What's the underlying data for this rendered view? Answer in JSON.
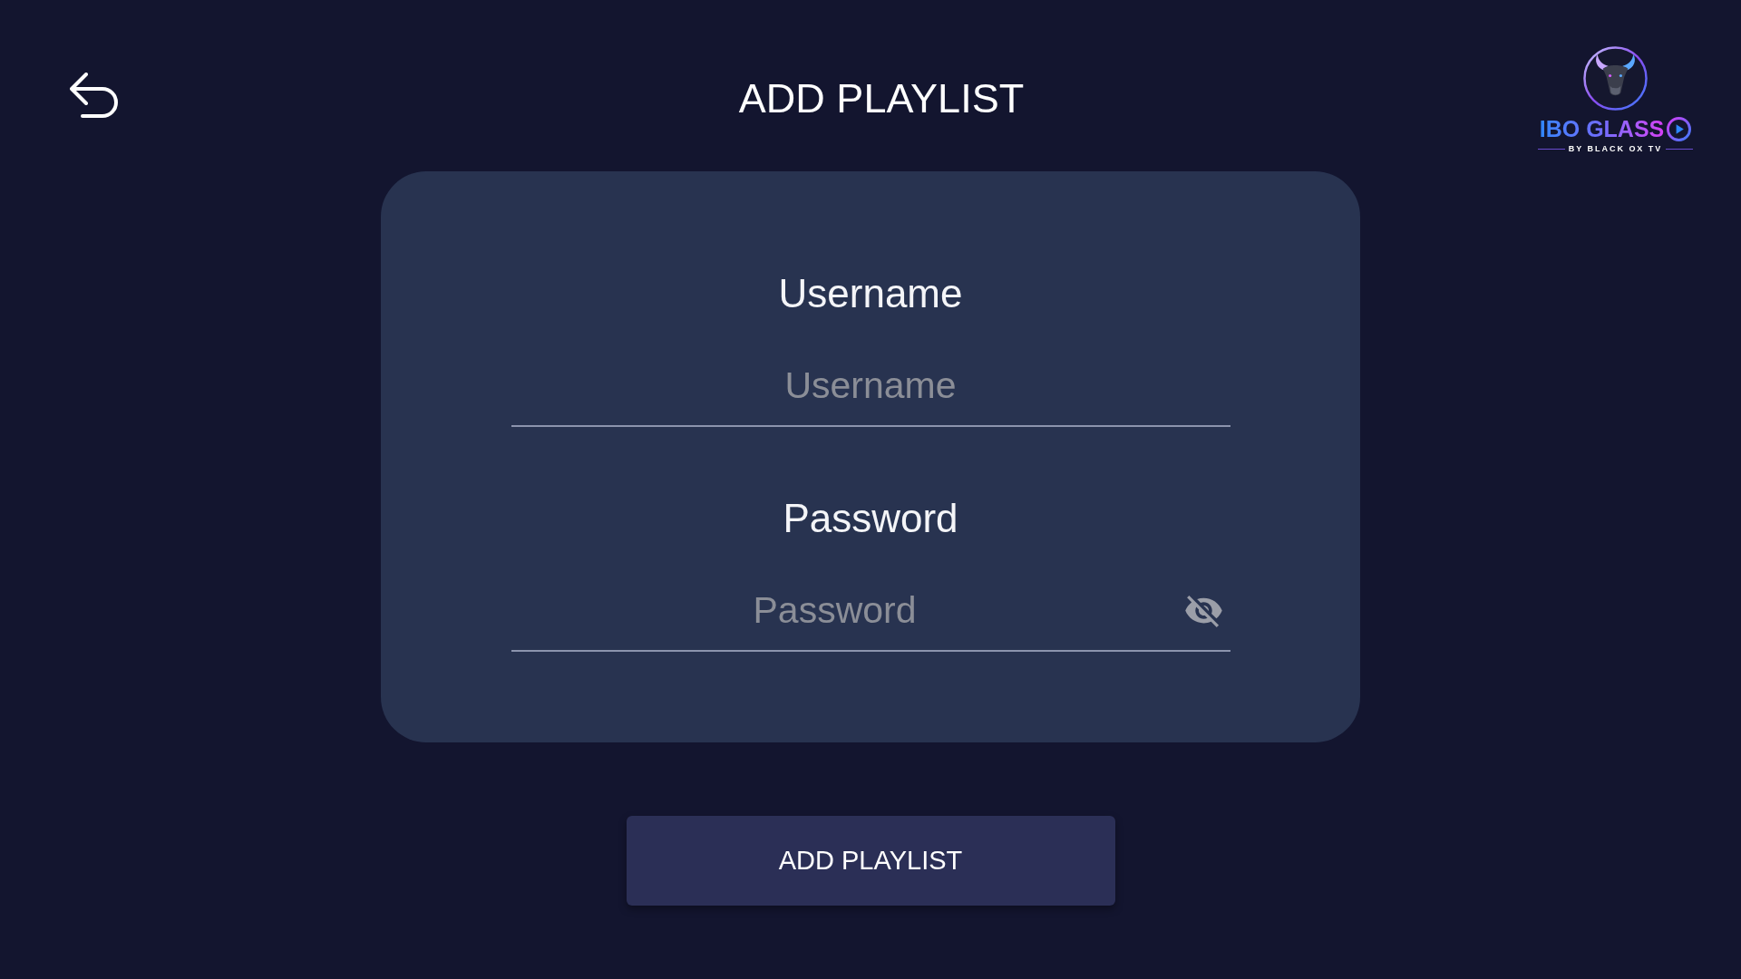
{
  "header": {
    "title": "ADD PLAYLIST"
  },
  "logo": {
    "name": "IBO GLASS",
    "tagline": "BY BLACK OX TV"
  },
  "form": {
    "fields": [
      {
        "kind": "text",
        "label": "Username",
        "placeholder": "Username"
      },
      {
        "kind": "password",
        "label": "Password",
        "placeholder": "Password",
        "revealed": false
      }
    ]
  },
  "submit_button": {
    "label": "ADD PLAYLIST"
  }
}
